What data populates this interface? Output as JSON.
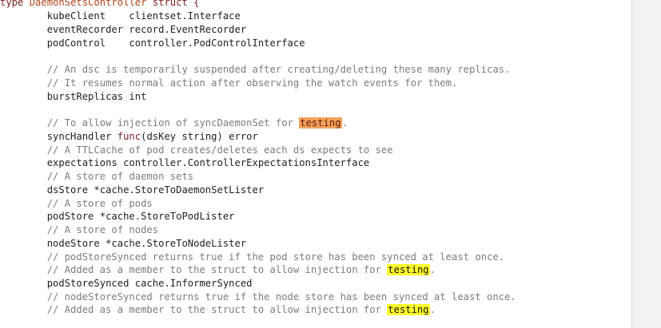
{
  "code": {
    "header": {
      "kw_type": "type",
      "name": "DaemonSetsController",
      "kw_struct": "struct {"
    },
    "lines": [
      {
        "id": "kubeClient",
        "text": "        kubeClient    clientset.Interface"
      },
      {
        "id": "eventRecorder",
        "text": "        eventRecorder record.EventRecorder"
      },
      {
        "id": "podControl",
        "text": "        podControl    controller.PodControlInterface"
      },
      {
        "id": "blank1",
        "text": ""
      },
      {
        "id": "cm1",
        "text": "        // An dsc is temporarily suspended after creating/deleting these many replicas."
      },
      {
        "id": "cm2",
        "text": "        // It resumes normal action after observing the watch events for them."
      },
      {
        "id": "burstReplicas",
        "text": "        burstReplicas int"
      },
      {
        "id": "blank2",
        "text": ""
      }
    ],
    "sync_comment_prefix": "        // To allow injection of syncDaemonSet for ",
    "sync_comment_highlight": "testing",
    "sync_comment_suffix": ".",
    "sync_handler_prefix": "        syncHandler ",
    "sync_handler_func": "func",
    "sync_handler_suffix": "(dsKey string) error",
    "lines2": [
      {
        "id": "cm3",
        "text": "        // A TTLCache of pod creates/deletes each ds expects to see",
        "comment": true
      },
      {
        "id": "expectations",
        "text": "        expectations controller.ControllerExpectationsInterface",
        "comment": false
      },
      {
        "id": "cm4",
        "text": "        // A store of daemon sets",
        "comment": true
      },
      {
        "id": "dsStore",
        "text": "        dsStore *cache.StoreToDaemonSetLister",
        "comment": false
      },
      {
        "id": "cm5",
        "text": "        // A store of pods",
        "comment": true
      },
      {
        "id": "podStore",
        "text": "        podStore *cache.StoreToPodLister",
        "comment": false
      },
      {
        "id": "cm6",
        "text": "        // A store of nodes",
        "comment": true
      },
      {
        "id": "nodeStore",
        "text": "        nodeStore *cache.StoreToNodeLister",
        "comment": false
      },
      {
        "id": "cm7",
        "text": "        // podStoreSynced returns true if the pod store has been synced at least once.",
        "comment": true
      }
    ],
    "added_comment_prefix": "        // Added as a member to the struct to allow injection for ",
    "added_comment_highlight": "testing",
    "added_comment_suffix": ".",
    "podStoreSynced": "        podStoreSynced cache.InformerSynced",
    "cm8": "        // nodeStoreSynced returns true if the node store has been synced at least once.",
    "added2_prefix": "        // Added as a member to the struct to allow injection for ",
    "added2_highlight": "testing",
    "added2_suffix": "."
  },
  "colors": {
    "keyword": "#7a1e1e",
    "type_name": "#b5451b",
    "comment": "#7c7c7c",
    "highlight_orange": "#f3a15a",
    "highlight_yellow": "#ffff2a"
  }
}
